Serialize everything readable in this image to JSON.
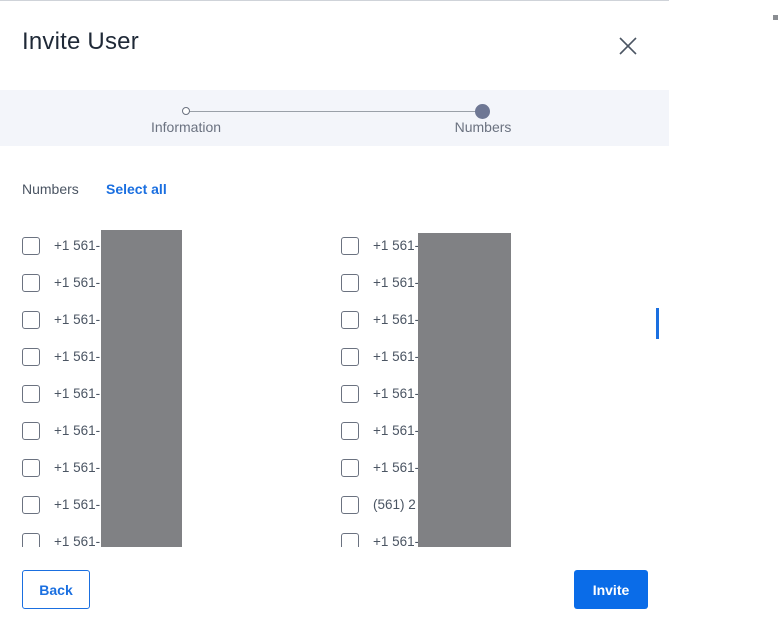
{
  "dialog": {
    "title": "Invite User",
    "close_icon": "close-icon"
  },
  "stepper": {
    "steps": [
      {
        "label": "Information",
        "state": "completed"
      },
      {
        "label": "Numbers",
        "state": "active"
      }
    ]
  },
  "numbers": {
    "section_label": "Numbers",
    "select_all_label": "Select all",
    "left_column": [
      "+1 561-",
      "+1 561-",
      "+1 561-",
      "+1 561-",
      "+1 561-",
      "+1 561-",
      "+1 561-",
      "+1 561-",
      "+1 561-"
    ],
    "right_column": [
      "+1 561-",
      "+1 561-",
      "+1 561-",
      "+1 561-",
      "+1 561-",
      "+1 561-",
      "+1 561-",
      "(561) 2",
      "+1 561-"
    ]
  },
  "footer": {
    "back_label": "Back",
    "invite_label": "Invite"
  },
  "colors": {
    "accent": "#1a6fe0",
    "primary_button": "#0a6ce8",
    "stepper_bg": "#f3f5fa",
    "redaction": "#808184"
  }
}
